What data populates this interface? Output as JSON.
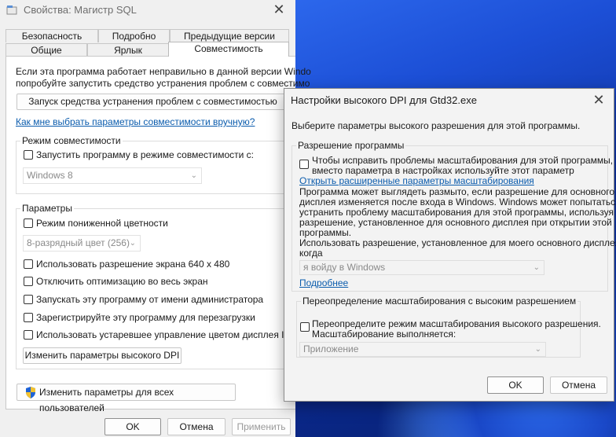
{
  "props": {
    "title": "Свойства: Магистр SQL",
    "tabs_row1": [
      "Безопасность",
      "Подробно",
      "Предыдущие версии"
    ],
    "tabs_row2": [
      "Общие",
      "Ярлык",
      "Совместимость"
    ],
    "intro_line1": "Если эта программа работает неправильно в данной версии Windo",
    "intro_line2": "попробуйте запустить средство устранения проблем с совместимо",
    "run_troubleshooter_button": "Запуск средства устранения проблем с совместимостью",
    "manual_link": "Как мне выбрать параметры совместимости вручную?",
    "compat_mode": {
      "label": "Режим совместимости",
      "checkbox_label": "Запустить программу в режиме совместимости с:",
      "select_value": "Windows 8"
    },
    "settings": {
      "label": "Параметры",
      "reduced_color_label": "Режим пониженной цветности",
      "color_select_value": "8-разрядный цвет (256)",
      "res_640_label": "Использовать разрешение экрана 640 x 480",
      "disable_fullscreen_label": "Отключить оптимизацию во весь экран",
      "run_admin_label": "Запускать эту программу от имени администратора",
      "register_restart_label": "Зарегистрируйте эту программу для перезагрузки",
      "legacy_icc_label": "Использовать устаревшее управление цветом дисплея ICC",
      "change_dpi_button": "Изменить параметры высокого DPI"
    },
    "all_users_button": "Изменить параметры для всех пользователей",
    "ok_button": "OK",
    "cancel_button": "Отмена",
    "apply_button": "Применить"
  },
  "dpi": {
    "title": "Настройки высокого DPI для Gtd32.exe",
    "intro": "Выберите параметры высокого разрешения для этой программы.",
    "program_dpi": {
      "label": "Разрешение программы",
      "checkbox_line1": "Чтобы исправить проблемы масштабирования для этой программы,",
      "checkbox_line2": "вместо параметра в настройках используйте этот параметр",
      "advanced_link": "Открыть расширенные параметры масштабирования",
      "desc_line1": "Программа может выглядеть размыто, если разрешение для основного",
      "desc_line2": "дисплея изменяется после входа в Windows. Windows может попытаться",
      "desc_line3": "устранить проблему масштабирования для этой программы, используя",
      "desc_line4": "разрешение, установленное для основного дисплея при открытии этой",
      "desc_line5": "программы.",
      "use_line1": "Использовать разрешение, установленное для моего основного дисплея,",
      "use_line2": "когда",
      "select_value": "я войду в Windows",
      "more_link": "Подробнее"
    },
    "override": {
      "label": "Переопределение масштабирования с высоким разрешением",
      "checkbox_line1": "Переопределите режим масштабирования высокого разрешения.",
      "checkbox_line2": "Масштабирование выполняется:",
      "select_value": "Приложение"
    },
    "ok_button": "OK",
    "cancel_button": "Отмена"
  },
  "icons": {
    "app": "app-icon",
    "shield": "uac-shield-icon",
    "close": "close-icon",
    "chevron": "chevron-down-icon"
  }
}
